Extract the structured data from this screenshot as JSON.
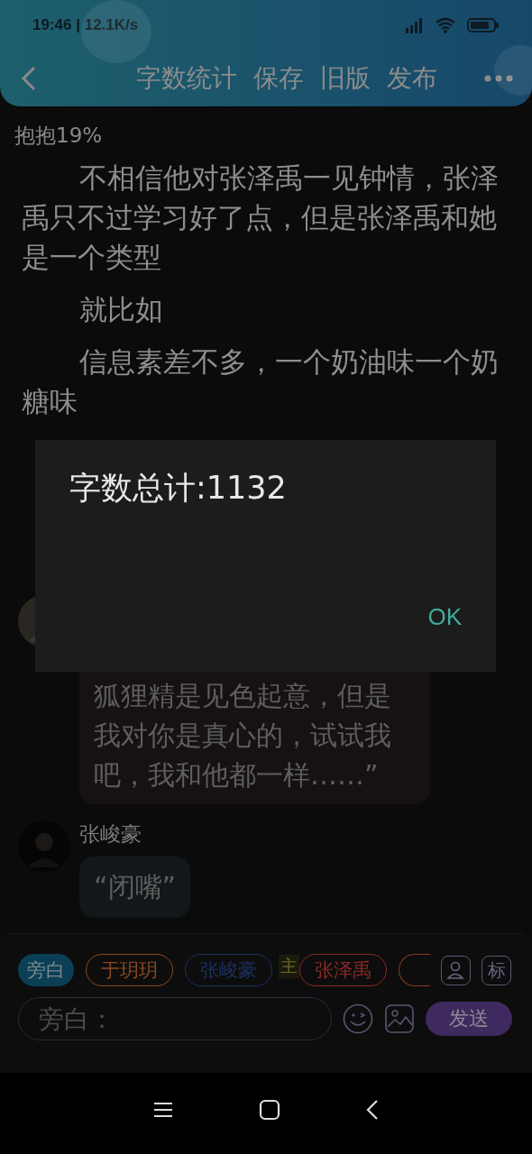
{
  "status_bar": {
    "time": "19:46 | 12.1K/s"
  },
  "header": {
    "actions": [
      "字数统计",
      "保存",
      "旧版",
      "发布"
    ]
  },
  "chapter": {
    "progress": "抱抱19%"
  },
  "paragraphs": [
    "不相信他对张泽禹一见钟情，张泽禹只不过学习好了点，但是张泽禹和她是一个类型",
    "就比如",
    "信息素差不多，一个奶油味一个奶糖味"
  ],
  "messages": [
    {
      "text": "狐狸精是见色起意，但是我对你是真心的，试试我吧，我和他都一样……”",
      "color": "#171212"
    },
    {
      "speaker": "张峻豪",
      "text": "“闭嘴”",
      "color": "#12171a"
    }
  ],
  "roles": [
    {
      "label": "旁白",
      "color": "#0b3f55",
      "selected": true
    },
    {
      "label": "于玥玥",
      "color": "#8a4a22",
      "selected": false
    },
    {
      "label": "张峻豪",
      "color": "#1d3060",
      "selected": false
    },
    {
      "label": "张泽禹",
      "color": "#8a2a25",
      "selected": false,
      "badge": "主"
    }
  ],
  "side_buttons": [
    "标"
  ],
  "input": {
    "placeholder": "旁白："
  },
  "send": "发送",
  "dialog": {
    "title": "字数总计:1132",
    "button": "OK"
  }
}
